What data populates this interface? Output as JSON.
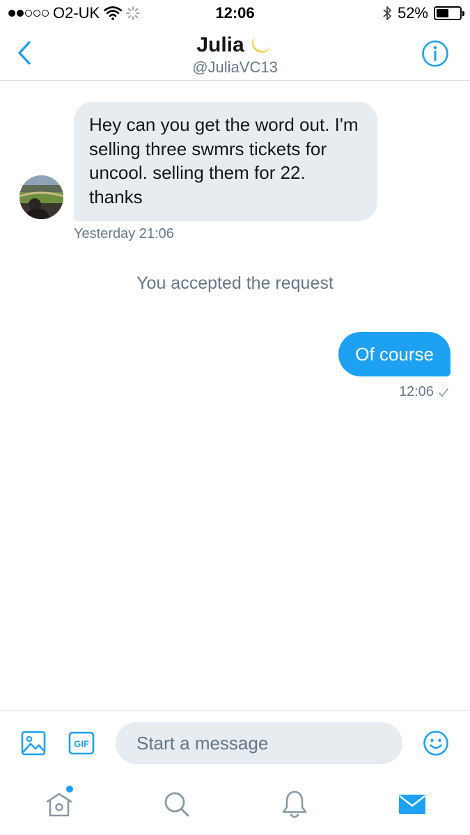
{
  "status_bar": {
    "carrier": "O2-UK",
    "time": "12:06",
    "battery_percent_label": "52%",
    "battery_level": 0.52,
    "signal_bars_filled": 2,
    "signal_bars_total": 5
  },
  "header": {
    "name": "Julia",
    "handle": "@JuliaVC13",
    "name_emoji": "moon-emoji"
  },
  "conversation": {
    "incoming": {
      "text": "Hey can you get the word out. I'm selling three swmrs tickets for uncool. selling them for 22. thanks",
      "timestamp": "Yesterday 21:06"
    },
    "system_message": "You accepted the request",
    "outgoing": {
      "text": "Of course",
      "timestamp": "12:06"
    }
  },
  "composer": {
    "placeholder": "Start a message",
    "gif_label": "GIF"
  },
  "tabbar": {
    "items": [
      "home-icon",
      "search-icon",
      "notifications-icon",
      "messages-icon"
    ],
    "active": "messages-icon"
  },
  "colors": {
    "accent": "#1da1f2",
    "bubble_in": "#e6ecf0",
    "muted_text": "#657786",
    "tab_inactive": "#8899a6"
  }
}
